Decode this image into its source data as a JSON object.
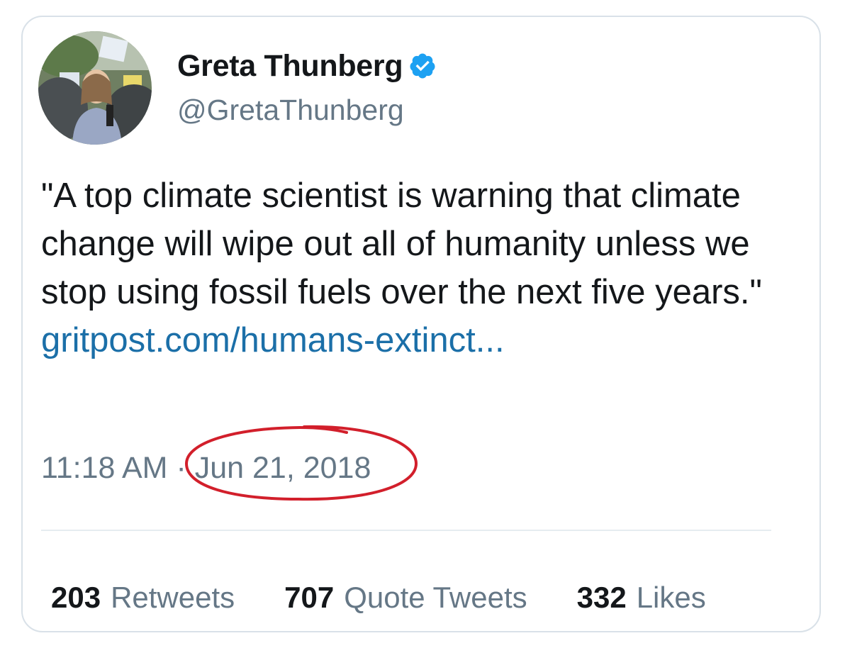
{
  "tweet": {
    "author": {
      "display_name": "Greta Thunberg",
      "handle": "@GretaThunberg",
      "verified": true,
      "verified_icon": "verified-badge-icon",
      "avatar": "profile-photo"
    },
    "text": "\"A top climate scientist is warning that climate change will wipe out all of humanity unless we stop using fossil fuels over the next five years.\"",
    "link": "gritpost.com/humans-extinct...",
    "time": "11:18 AM",
    "separator": "·",
    "date": "Jun 21, 2018",
    "date_annotation": "red-ellipse",
    "stats": [
      {
        "count": "203",
        "label": "Retweets"
      },
      {
        "count": "707",
        "label": "Quote Tweets"
      },
      {
        "count": "332",
        "label": "Likes"
      }
    ]
  },
  "colors": {
    "text": "#14171a",
    "secondary": "#657786",
    "link": "#1b6fa8",
    "verified": "#1da1f2",
    "annotation": "#d21f2b",
    "border": "#d9e1e8"
  }
}
